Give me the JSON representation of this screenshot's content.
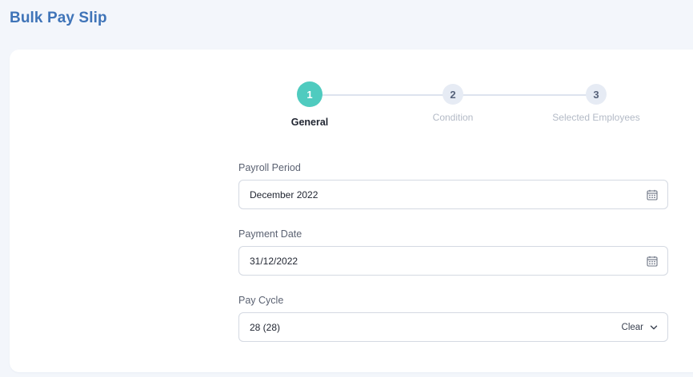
{
  "page": {
    "title": "Bulk Pay Slip"
  },
  "stepper": {
    "steps": [
      {
        "number": "1",
        "label": "General",
        "state": "active"
      },
      {
        "number": "2",
        "label": "Condition",
        "state": "inactive"
      },
      {
        "number": "3",
        "label": "Selected Employees",
        "state": "inactive"
      }
    ]
  },
  "form": {
    "payroll_period": {
      "label": "Payroll Period",
      "value": "December 2022",
      "icon": "calendar-icon"
    },
    "payment_date": {
      "label": "Payment Date",
      "value": "31/12/2022",
      "icon": "calendar-icon"
    },
    "pay_cycle": {
      "label": "Pay Cycle",
      "value": "28 (28)",
      "clear_label": "Clear",
      "icon": "chevron-down-icon"
    }
  },
  "colors": {
    "title": "#3f74b8",
    "active_step": "#4fcbbf",
    "inactive_step": "#e6ebf4",
    "background": "#f3f6fb"
  }
}
